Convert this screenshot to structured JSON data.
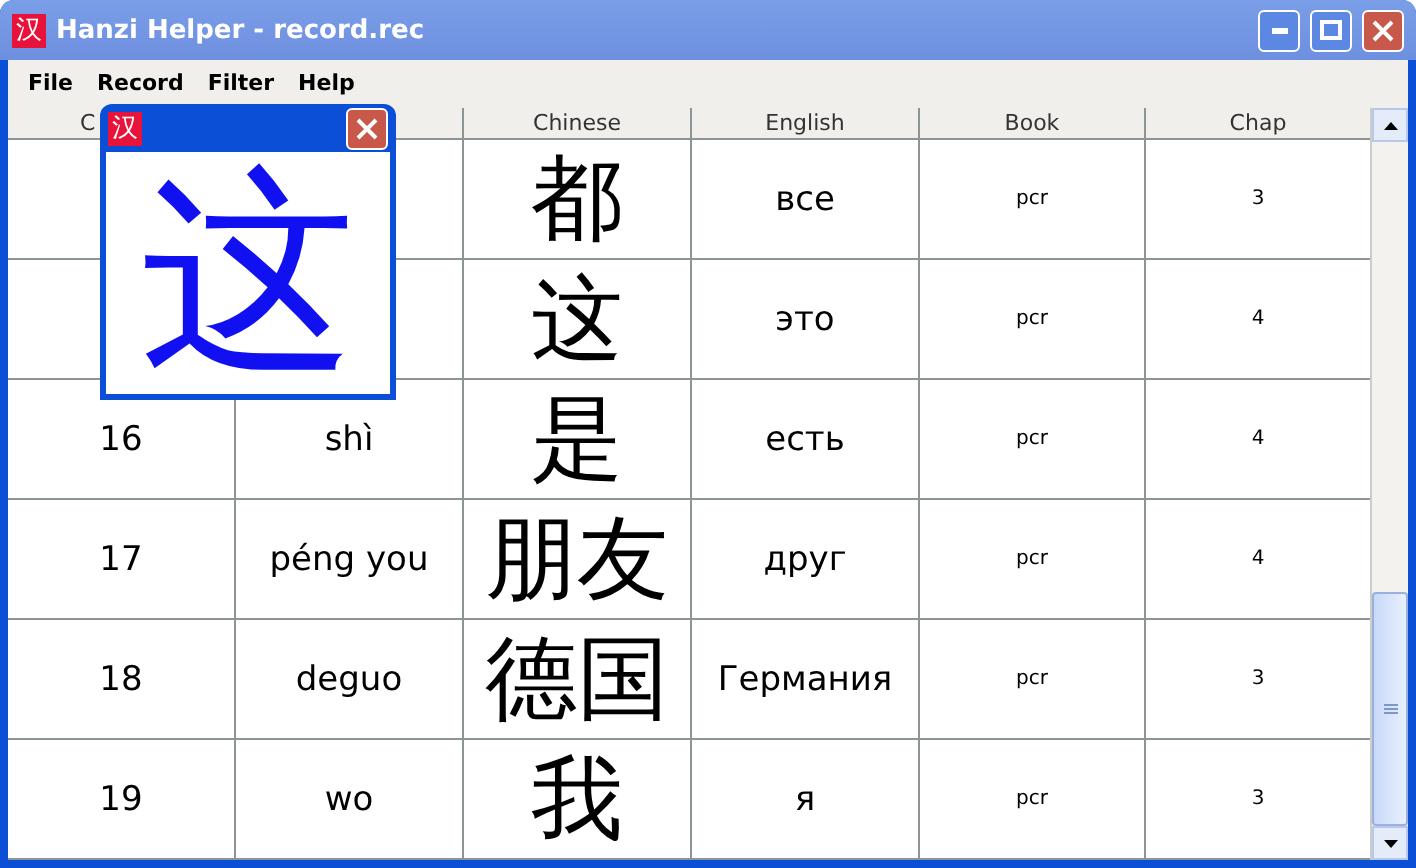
{
  "window": {
    "icon": "汉",
    "title": "Hanzi Helper - record.rec"
  },
  "menu": [
    "File",
    "Record",
    "Filter",
    "Help"
  ],
  "table": {
    "columns": [
      "C",
      "",
      "Chinese",
      "English",
      "Book",
      "Chap"
    ],
    "rows": [
      {
        "hanzi": "都",
        "english": "все",
        "book": "pcr",
        "chap": "3"
      },
      {
        "hanzi": "这",
        "english": "это",
        "book": "pcr",
        "chap": "4"
      },
      {
        "number": "16",
        "pinyin": "shì",
        "hanzi": "是",
        "english": "есть",
        "book": "pcr",
        "chap": "4"
      },
      {
        "number": "17",
        "pinyin": "péng you",
        "hanzi": "朋友",
        "english": "друг",
        "book": "pcr",
        "chap": "4"
      },
      {
        "number": "18",
        "pinyin": "deguo",
        "hanzi": "德国",
        "english": "Германия",
        "book": "pcr",
        "chap": "3"
      },
      {
        "number": "19",
        "pinyin": "wo",
        "hanzi": "我",
        "english": "я",
        "book": "pcr",
        "chap": "3"
      }
    ]
  },
  "popup": {
    "icon": "汉",
    "character": "这"
  }
}
